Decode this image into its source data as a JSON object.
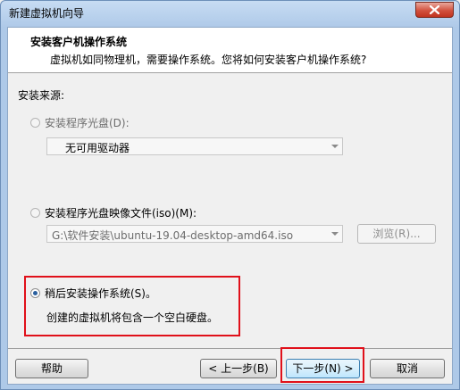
{
  "window": {
    "title": "新建虚拟机向导"
  },
  "header": {
    "title": "安装客户机操作系统",
    "description": "虚拟机如同物理机，需要操作系统。您将如何安装客户机操作系统?"
  },
  "source": {
    "label": "安装来源:",
    "option_disc": {
      "label": "安装程序光盘(D):",
      "selected": false,
      "enabled": false,
      "combo_value": "无可用驱动器"
    },
    "option_iso": {
      "label": "安装程序光盘映像文件(iso)(M):",
      "selected": false,
      "enabled": false,
      "combo_value": "G:\\软件安装\\ubuntu-19.04-desktop-amd64.iso",
      "browse_label": "浏览(R)..."
    },
    "option_later": {
      "label": "稍后安装操作系统(S)。",
      "selected": true,
      "enabled": true,
      "description": "创建的虚拟机将包含一个空白硬盘。"
    }
  },
  "footer": {
    "help_label": "帮助",
    "back_label": "< 上一步(B)",
    "next_label": "下一步(N) >",
    "cancel_label": "取消"
  },
  "colors": {
    "highlight": "#e0101a",
    "radio_dot": "#2a5f9e"
  }
}
